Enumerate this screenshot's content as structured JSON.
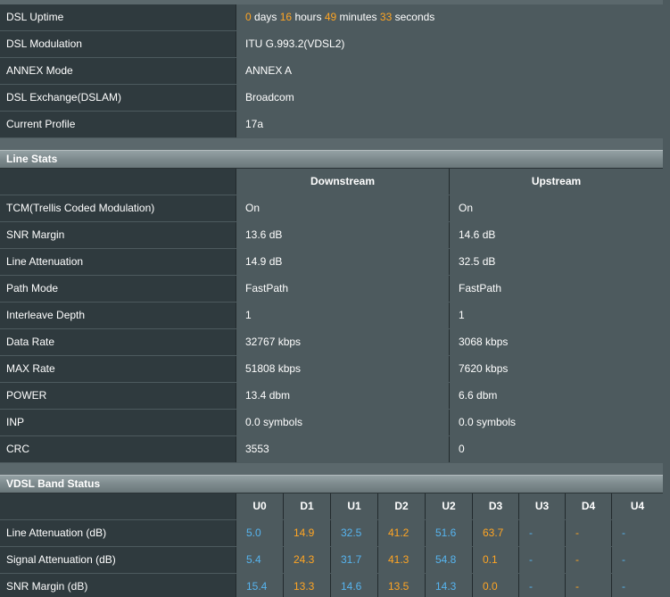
{
  "dsl_info": {
    "uptime": {
      "label": "DSL Uptime",
      "days": "0",
      "days_unit": "days",
      "hours": "16",
      "hours_unit": "hours",
      "minutes": "49",
      "minutes_unit": "minutes",
      "seconds": "33",
      "seconds_unit": "seconds"
    },
    "modulation": {
      "label": "DSL Modulation",
      "value": "ITU G.993.2(VDSL2)"
    },
    "annex": {
      "label": "ANNEX Mode",
      "value": "ANNEX A"
    },
    "exchange": {
      "label": "DSL Exchange(DSLAM)",
      "value": "Broadcom"
    },
    "profile": {
      "label": "Current Profile",
      "value": "17a"
    }
  },
  "line_stats": {
    "title": "Line Stats",
    "col_down": "Downstream",
    "col_up": "Upstream",
    "rows": [
      {
        "label": "TCM(Trellis Coded Modulation)",
        "down": "On",
        "up": "On"
      },
      {
        "label": "SNR Margin",
        "down": "13.6 dB",
        "up": "14.6 dB"
      },
      {
        "label": "Line Attenuation",
        "down": "14.9 dB",
        "up": "32.5 dB"
      },
      {
        "label": "Path Mode",
        "down": "FastPath",
        "up": "FastPath"
      },
      {
        "label": "Interleave Depth",
        "down": "1",
        "up": "1"
      },
      {
        "label": "Data Rate",
        "down": "32767 kbps",
        "up": "3068 kbps"
      },
      {
        "label": "MAX Rate",
        "down": "51808 kbps",
        "up": "7620 kbps"
      },
      {
        "label": "POWER",
        "down": "13.4 dbm",
        "up": "6.6 dbm"
      },
      {
        "label": "INP",
        "down": "0.0 symbols",
        "up": "0.0 symbols"
      },
      {
        "label": "CRC",
        "down": "3553",
        "up": "0"
      }
    ]
  },
  "band_status": {
    "title": "VDSL Band Status",
    "bands": [
      "U0",
      "D1",
      "U1",
      "D2",
      "U2",
      "D3",
      "U3",
      "D4",
      "U4"
    ],
    "rows": [
      {
        "label": "Line Attenuation (dB)",
        "values": [
          "5.0",
          "14.9",
          "32.5",
          "41.2",
          "51.6",
          "63.7",
          "-",
          "-",
          "-"
        ]
      },
      {
        "label": "Signal Attenuation (dB)",
        "values": [
          "5.4",
          "24.3",
          "31.7",
          "41.3",
          "54.8",
          "0.1",
          "-",
          "-",
          "-"
        ]
      },
      {
        "label": "SNR Margin (dB)",
        "values": [
          "15.4",
          "13.3",
          "14.6",
          "13.5",
          "14.3",
          "0.0",
          "-",
          "-",
          "-"
        ]
      }
    ]
  },
  "colors": {
    "upstream_value": "#56b4ef",
    "downstream_value": "#ffa523",
    "label_bg": "#2f3a3e",
    "value_bg": "#4d5a5e"
  }
}
